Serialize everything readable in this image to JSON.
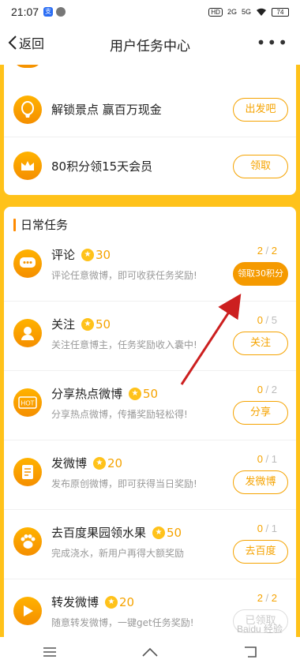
{
  "status_bar": {
    "time": "21:07",
    "hd": "HD",
    "net1": "2G",
    "net2": "5G",
    "battery": "74"
  },
  "nav": {
    "back_label": "返回",
    "title": "用户任务中心",
    "more": "•••"
  },
  "top_tasks": [
    {
      "title": "解锁景点 赢百万现金",
      "button": "出发吧",
      "icon": "balloon-icon"
    },
    {
      "title": "80积分领15天会员",
      "button": "领取",
      "icon": "crown-icon"
    }
  ],
  "daily": {
    "header": "日常任务",
    "tasks": [
      {
        "title": "评论",
        "points": "30",
        "desc": "评论任意微博，即可收获任务奖励!",
        "progress_done": "2",
        "progress_total": "2",
        "button": "领取30积分",
        "state": "filled",
        "icon": "comment-icon"
      },
      {
        "title": "关注",
        "points": "50",
        "desc": "关注任意博主，任务奖励收入囊中!",
        "progress_done": "0",
        "progress_total": "5",
        "button": "关注",
        "state": "outline",
        "icon": "user-icon"
      },
      {
        "title": "分享热点微博",
        "points": "50",
        "desc": "分享热点微博，传播奖励轻松得!",
        "progress_done": "0",
        "progress_total": "2",
        "button": "分享",
        "state": "outline",
        "icon": "hot-icon"
      },
      {
        "title": "发微博",
        "points": "20",
        "desc": "发布原创微博，即可获得当日奖励!",
        "progress_done": "0",
        "progress_total": "1",
        "button": "发微博",
        "state": "outline",
        "icon": "edit-icon"
      },
      {
        "title": "去百度果园领水果",
        "points": "50",
        "desc": "完成浇水，新用户再得大额奖励",
        "progress_done": "0",
        "progress_total": "1",
        "button": "去百度",
        "state": "outline",
        "icon": "paw-icon"
      },
      {
        "title": "转发微博",
        "points": "20",
        "desc": "随意转发微博，一键get任务奖励!",
        "progress_done": "2",
        "progress_total": "2",
        "button": "已领取",
        "state": "disabled",
        "icon": "forward-icon"
      }
    ]
  },
  "progress_sep": " / ",
  "star_glyph": "★",
  "watermark": "Baidu 经验",
  "colors": {
    "accent": "#f5a300",
    "background": "#ffc21a",
    "arrow": "#cc1f1f"
  }
}
